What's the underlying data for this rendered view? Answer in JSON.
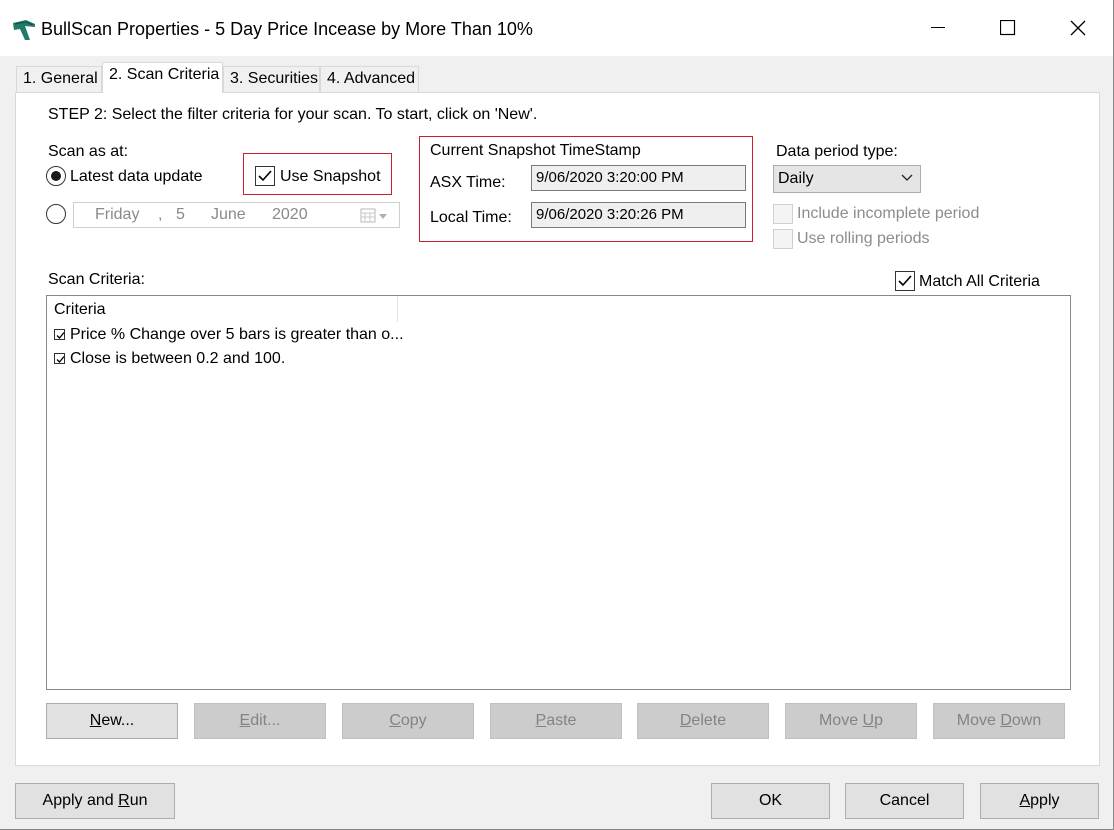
{
  "window": {
    "title": "BullScan Properties - 5 Day Price Incease by More Than 10%"
  },
  "tabs": [
    {
      "label": "1. General"
    },
    {
      "label": "2. Scan Criteria"
    },
    {
      "label": "3. Securities"
    },
    {
      "label": "4. Advanced"
    }
  ],
  "active_tab": "2. Scan Criteria",
  "step_text": "STEP 2: Select the filter criteria for your scan. To start, click on 'New'.",
  "scan_as_at": {
    "label": "Scan as at:",
    "latest_label": "Latest data update",
    "latest_selected": true,
    "date": {
      "weekday": "Friday",
      "sep": ",",
      "day": "5",
      "month": "June",
      "year": "2020"
    },
    "use_snapshot_label": "Use Snapshot",
    "use_snapshot_checked": true
  },
  "snapshot": {
    "title": "Current Snapshot TimeStamp",
    "asx_label": "ASX Time:",
    "asx_value": "9/06/2020 3:20:00 PM",
    "local_label": "Local Time:",
    "local_value": "9/06/2020 3:20:26 PM"
  },
  "data_period": {
    "label": "Data period type:",
    "selected": "Daily",
    "include_incomplete_label": "Include incomplete period",
    "rolling_label": "Use rolling periods"
  },
  "criteria": {
    "label": "Scan Criteria:",
    "match_all_label": "Match All Criteria",
    "match_all_checked": true,
    "column_header": "Criteria",
    "rows": [
      {
        "text": "Price % Change over 5 bars is greater than o...",
        "checked": true
      },
      {
        "text": "Close is between 0.2 and 100.",
        "checked": true
      }
    ]
  },
  "grid_buttons": {
    "new": {
      "pre": "",
      "u": "N",
      "post": "ew..."
    },
    "edit": {
      "pre": "",
      "u": "E",
      "post": "dit..."
    },
    "copy": {
      "pre": "",
      "u": "C",
      "post": "opy"
    },
    "paste": {
      "pre": "",
      "u": "P",
      "post": "aste"
    },
    "delete": {
      "pre": "",
      "u": "D",
      "post": "elete"
    },
    "move_up": {
      "pre": "Move ",
      "u": "U",
      "post": "p"
    },
    "move_down": {
      "pre": "Move ",
      "u": "D",
      "post": "own"
    }
  },
  "footer": {
    "apply_run": {
      "pre": "Apply and ",
      "u": "R",
      "post": "un"
    },
    "ok": "OK",
    "cancel": "Cancel",
    "apply": {
      "pre": "",
      "u": "A",
      "post": "pply"
    }
  },
  "colors": {
    "highlight_border": "#c8202a",
    "window_bg": "#f0f0f0",
    "panel_bg": "#ffffff",
    "disabled_button": "#cccccc"
  }
}
